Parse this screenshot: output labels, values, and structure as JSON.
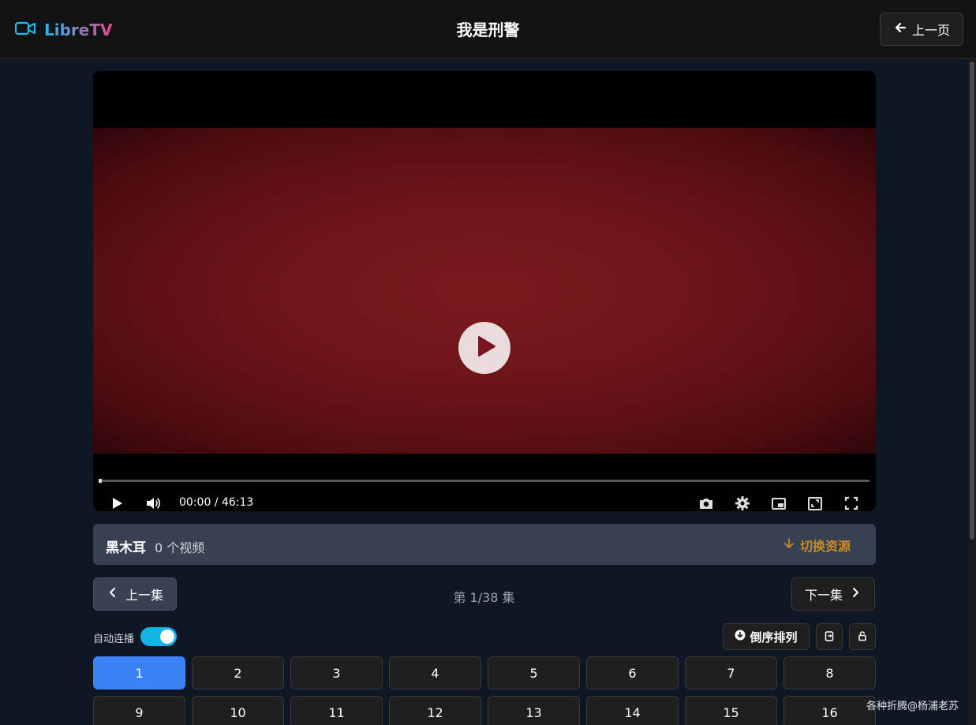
{
  "header": {
    "logo_text": "LibreTV",
    "title": "我是刑警",
    "back_label": "上一页"
  },
  "player": {
    "time": "00:00 / 46:13",
    "progress_fraction": 0,
    "icons": [
      "play-icon",
      "volume-icon",
      "screenshot-icon",
      "settings-icon",
      "pip-icon",
      "web-fullscreen-icon",
      "fullscreen-icon"
    ]
  },
  "source": {
    "name": "黑木耳",
    "count": "0 个视频",
    "switch_label": "切换资源"
  },
  "episode_nav": {
    "prev_label": "上一集",
    "next_label": "下一集",
    "indicator": "第 1/38 集"
  },
  "options": {
    "autoplay_label": "自动连播",
    "autoplay_on": true,
    "reverse_label": "倒序排列"
  },
  "episodes": [
    "1",
    "2",
    "3",
    "4",
    "5",
    "6",
    "7",
    "8",
    "9",
    "10",
    "11",
    "12",
    "13",
    "14",
    "15",
    "16"
  ],
  "active_episode": "1",
  "watermark": "各种折腾@杨浦老苏",
  "colors": {
    "accent": "#3b82f6",
    "toggle": "#11b5e4",
    "switch_source": "#c58b2b",
    "background": "#0f1624"
  }
}
